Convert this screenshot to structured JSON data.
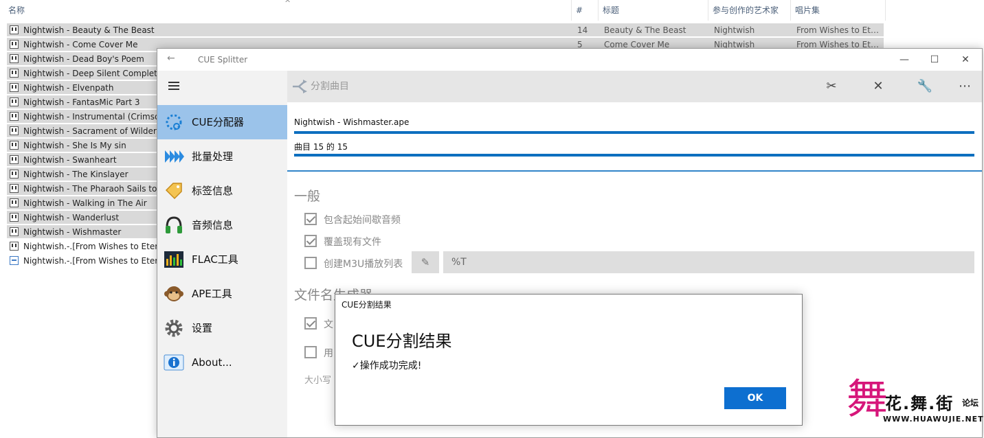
{
  "explorer": {
    "columns": {
      "name": "名称",
      "num": "#",
      "title": "标题",
      "artist": "参与创作的艺术家",
      "album": "唱片集"
    },
    "rows": [
      {
        "name": "Nightwish - Beauty & The Beast",
        "num": "14",
        "title": "Beauty & The Beast",
        "artist": "Nightwish",
        "album": "From Wishes to Ete..."
      },
      {
        "name": "Nightwish - Come Cover Me",
        "num": "5",
        "title": "Come Cover Me",
        "artist": "Nightwish",
        "album": "From Wishes to Ete..."
      },
      {
        "name": "Nightwish - Dead Boy's Poem"
      },
      {
        "name": "Nightwish - Deep Silent Complete"
      },
      {
        "name": "Nightwish - Elvenpath"
      },
      {
        "name": "Nightwish - FantasMic Part 3"
      },
      {
        "name": "Nightwish - Instrumental (Crimson"
      },
      {
        "name": "Nightwish - Sacrament of Wilderne"
      },
      {
        "name": "Nightwish - She Is My sin"
      },
      {
        "name": "Nightwish - Swanheart"
      },
      {
        "name": "Nightwish - The Kinslayer"
      },
      {
        "name": "Nightwish - The Pharaoh Sails to O"
      },
      {
        "name": "Nightwish - Walking in The Air"
      },
      {
        "name": "Nightwish - Wanderlust"
      },
      {
        "name": "Nightwish - Wishmaster"
      },
      {
        "name": "Nightwish.-.[From Wishes to Eterni"
      },
      {
        "name": "Nightwish.-.[From Wishes to Eterni"
      }
    ]
  },
  "app": {
    "title": "CUE Splitter",
    "nav": [
      {
        "label": "CUE分配器",
        "icon": "cue-splitter-icon"
      },
      {
        "label": "批量处理",
        "icon": "batch-icon"
      },
      {
        "label": "标签信息",
        "icon": "tag-icon"
      },
      {
        "label": "音频信息",
        "icon": "headphones-icon"
      },
      {
        "label": "FLAC工具",
        "icon": "equalizer-icon"
      },
      {
        "label": "APE工具",
        "icon": "monkey-icon"
      },
      {
        "label": "设置",
        "icon": "gear-icon"
      },
      {
        "label": "About...",
        "icon": "info-icon"
      }
    ],
    "command": {
      "title": "分割曲目"
    },
    "progress": {
      "file": "Nightwish - Wishmaster.ape",
      "track": "曲目 15 的 15",
      "file_fraction": 1.0,
      "track_fraction": 1.0
    },
    "general": {
      "heading": "一般",
      "opt1": "包含起始间歇音频",
      "opt2": "覆盖现有文件",
      "opt3": "创建M3U播放列表",
      "m3u_value": "%T"
    },
    "filename": {
      "heading": "文件名生成器",
      "opt1_partial": "文",
      "opt2_partial": "用",
      "case_partial": "大小写"
    }
  },
  "dialog": {
    "caption": "CUE分割结果",
    "title": "CUE分割结果",
    "message": "✓操作成功完成!",
    "ok": "OK"
  },
  "watermark": {
    "cn": "花.舞.街",
    "forum": "论坛",
    "url": "WWW.HUAWUJIE.NET"
  }
}
